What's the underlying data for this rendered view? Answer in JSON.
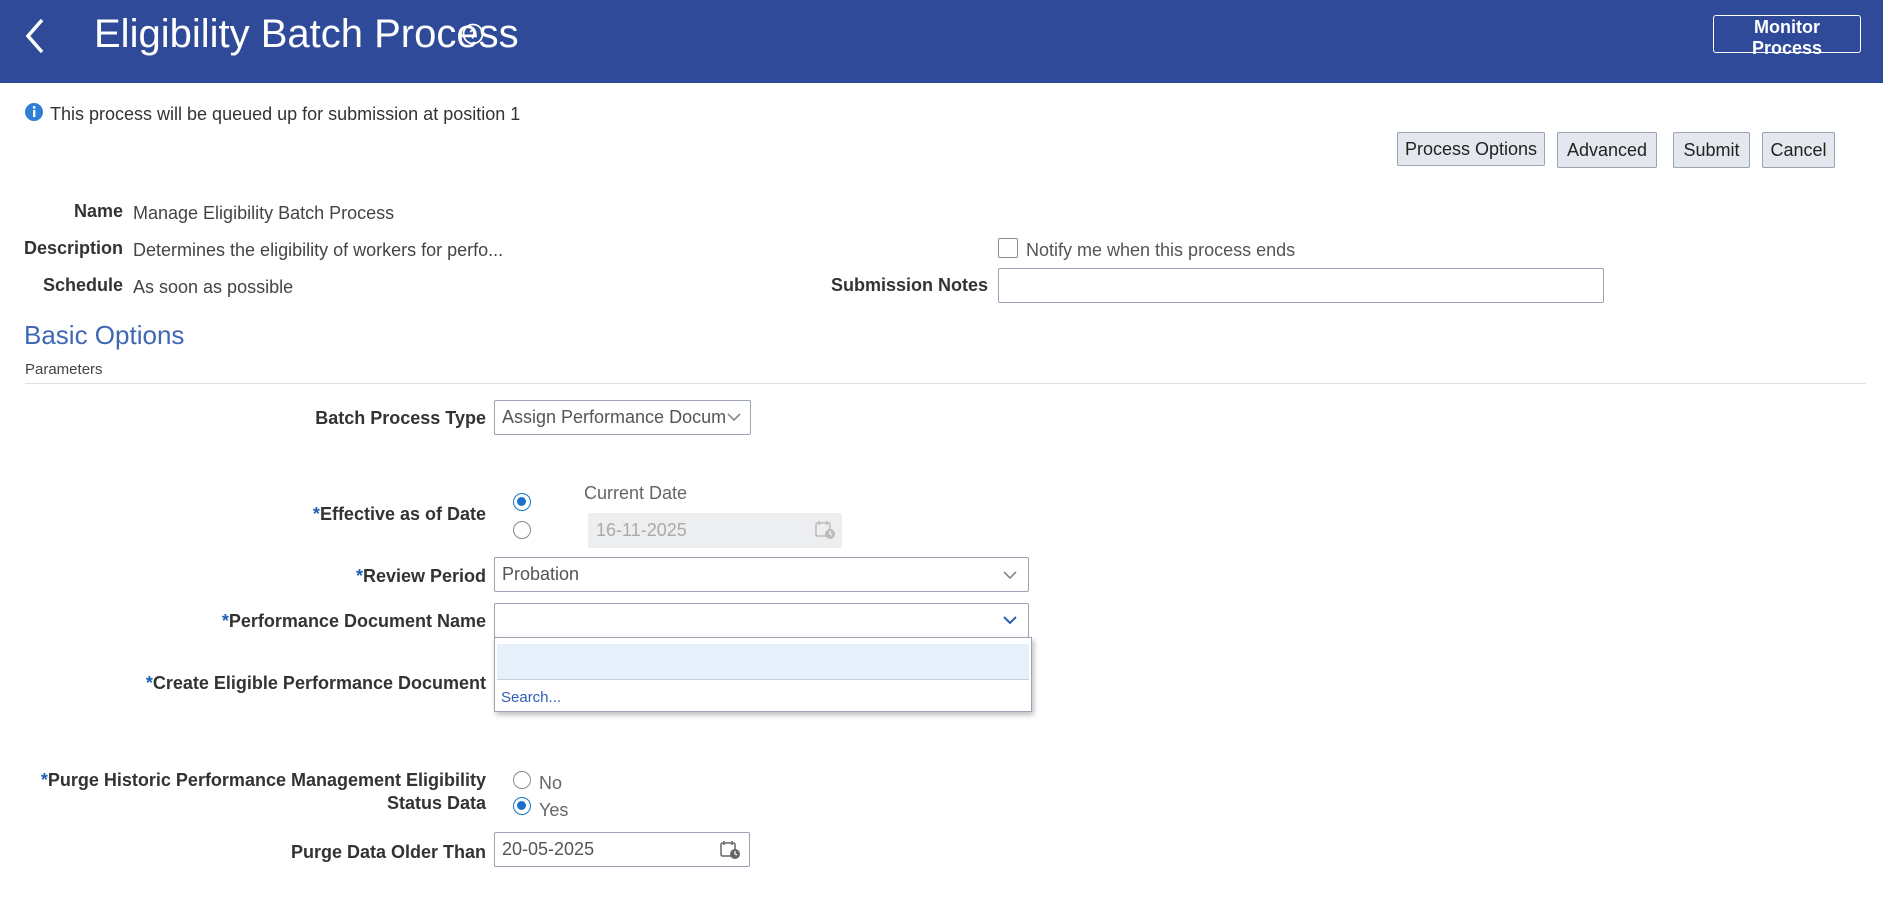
{
  "header": {
    "title": "Eligibility Batch Process",
    "monitor_label": "Monitor Process"
  },
  "info": {
    "message": "This process will be queued up for submission at position 1"
  },
  "actions": {
    "process_options": "Process Options",
    "advanced": "Advanced",
    "submit": "Submit",
    "cancel": "Cancel"
  },
  "details": {
    "name_label": "Name",
    "name_value": "Manage Eligibility Batch Process",
    "description_label": "Description",
    "description_value": "Determines the eligibility of workers for perfo...",
    "schedule_label": "Schedule",
    "schedule_value": "As soon as possible",
    "notify_label": "Notify me when this process ends",
    "notes_label": "Submission Notes",
    "notes_value": ""
  },
  "basic_options": {
    "section_title": "Basic Options",
    "parameters_label": "Parameters",
    "batch_type_label": "Batch Process Type",
    "batch_type_value": "Assign Performance Docum",
    "required_mark": "*",
    "effective_label": "Effective as of Date",
    "current_date_label": "Current Date",
    "effective_date_value": "16-11-2025",
    "review_period_label": "Review Period",
    "review_period_value": "Probation",
    "perf_doc_label": "Performance Document Name",
    "perf_doc_value": "",
    "dropdown_search": "Search...",
    "create_doc_label": "Create Eligible Performance Document",
    "purge_label_1": "Purge Historic Performance Management Eligibility",
    "purge_label_2": "Status Data",
    "purge_no": "No",
    "purge_yes": "Yes",
    "purge_older_label": "Purge Data Older Than",
    "purge_older_value": "20-05-2025"
  }
}
